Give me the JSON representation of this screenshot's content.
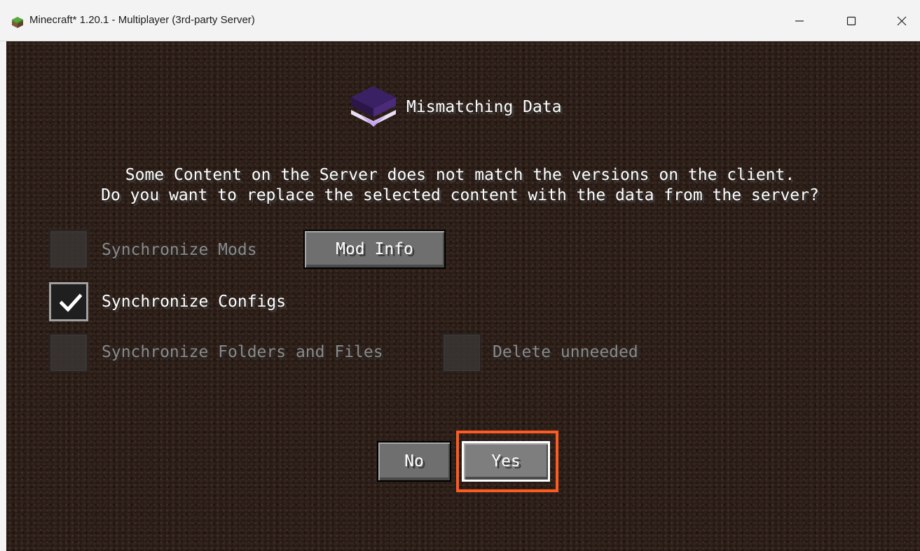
{
  "window": {
    "title": "Minecraft* 1.20.1 - Multiplayer (3rd-party Server)",
    "controls": {
      "minimize": "—",
      "maximize": "☐",
      "close": "✕"
    }
  },
  "dialog": {
    "title": "Mismatching Data",
    "message_line1": "Some Content on the Server does not match the versions on the client.",
    "message_line2": "Do you want to replace the selected content with the data from the server?",
    "options": [
      {
        "label": "Synchronize Mods",
        "checked": false,
        "enabled": false
      },
      {
        "label": "Synchronize Configs",
        "checked": true,
        "enabled": true
      },
      {
        "label": "Synchronize Folders and Files",
        "checked": false,
        "enabled": false
      },
      {
        "label": "Delete unneeded",
        "checked": false,
        "enabled": false
      }
    ],
    "mod_info_button": "Mod Info",
    "no_button": "No",
    "yes_button": "Yes"
  },
  "colors": {
    "highlight": "#ff5a1f",
    "background": "#2b1d16",
    "icon_purple": "#4b2a7a"
  },
  "icons": {
    "app": "minecraft-grass-block-icon",
    "header": "purple-layers-icon",
    "check": "checkmark-icon"
  }
}
